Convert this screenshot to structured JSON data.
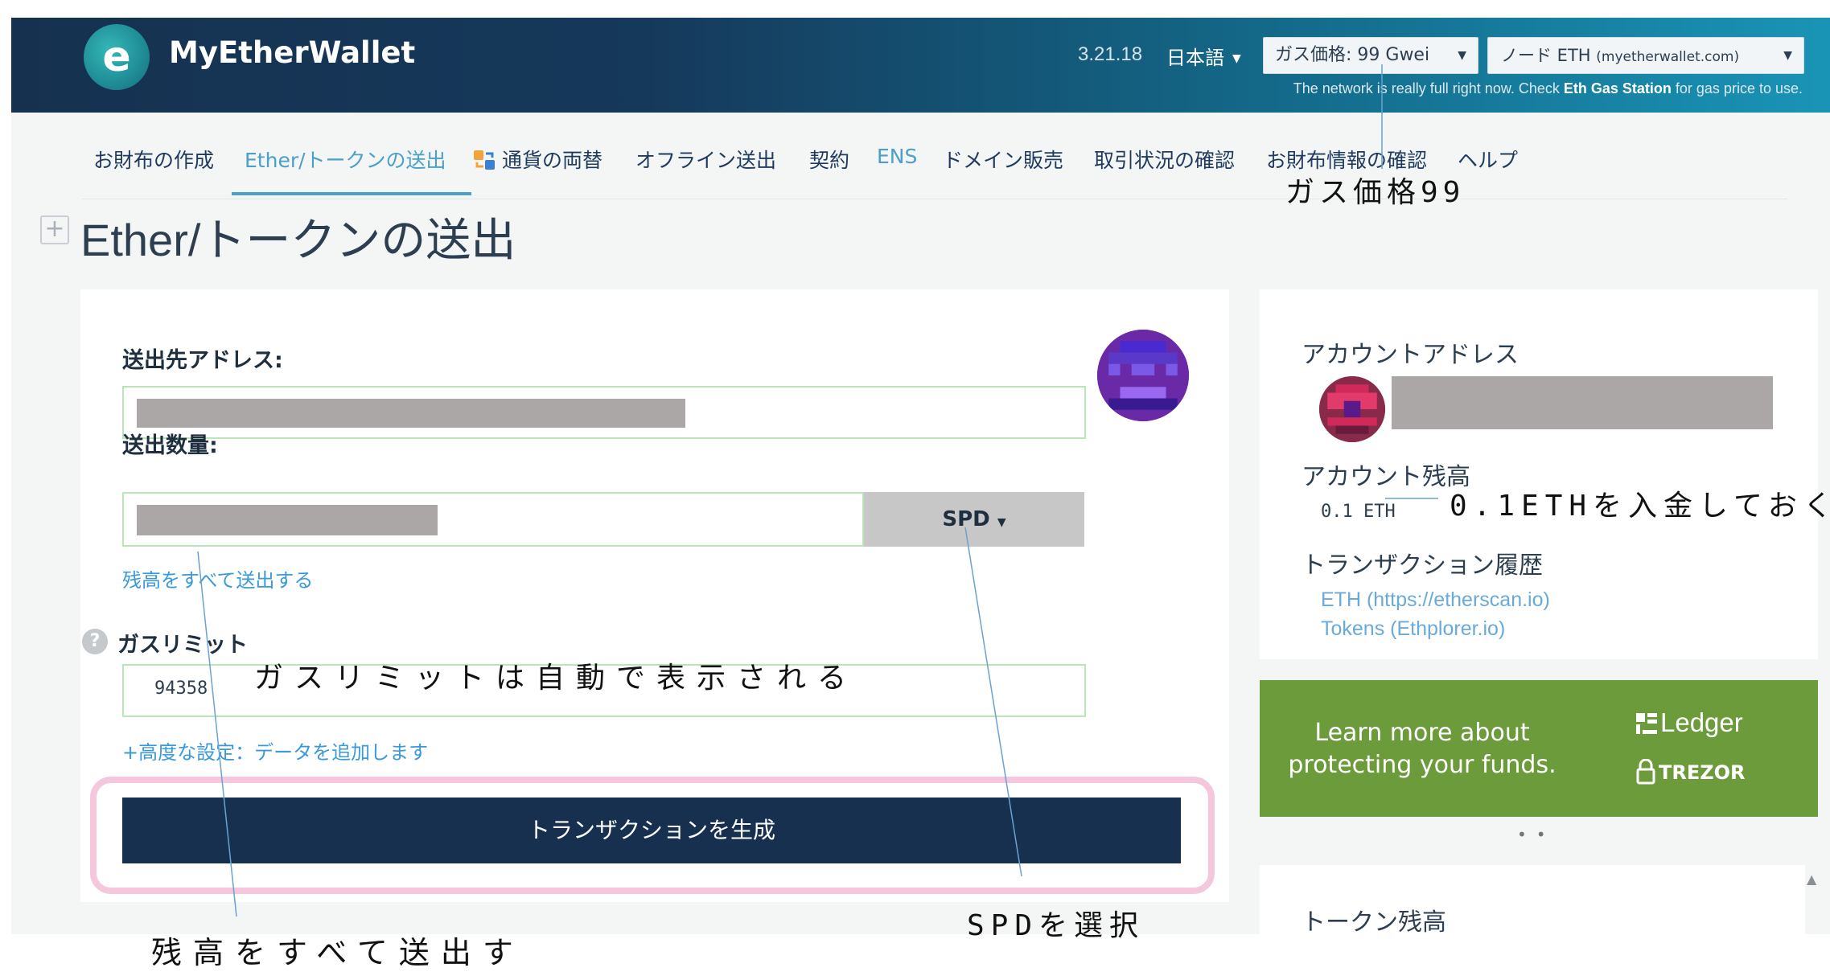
{
  "header": {
    "brand": "MyEtherWallet",
    "version": "3.21.18",
    "language": "日本語",
    "gas_price_button": "ガス価格: 99 Gwei",
    "node_button_main": "ノード ETH",
    "node_button_host": "(myetherwallet.com)",
    "network_note_prefix": "The network is really full right now. Check",
    "network_note_link": "Eth Gas Station",
    "network_note_suffix": "for gas price to use."
  },
  "nav": {
    "items": [
      {
        "label": "お財布の作成"
      },
      {
        "label": "Ether/トークンの送出"
      },
      {
        "label": "通貨の両替"
      },
      {
        "label": "オフライン送出"
      },
      {
        "label": "契約"
      },
      {
        "label": "ENS"
      },
      {
        "label": "ドメイン販売"
      },
      {
        "label": "取引状況の確認"
      },
      {
        "label": "お財布情報の確認"
      },
      {
        "label": "ヘルプ"
      }
    ],
    "active_index": 1
  },
  "page": {
    "expand_symbol": "+",
    "title_latin": "Ether/",
    "title_jp": "トークンの送出"
  },
  "send_form": {
    "to_address_label": "送出先アドレス:",
    "amount_label": "送出数量:",
    "unit": "SPD",
    "send_all_link": "残高をすべて送出する",
    "help_symbol": "?",
    "gas_limit_label": "ガスリミット",
    "gas_limit_value": "94358",
    "advanced_link": "+高度な設定：データを追加します",
    "generate_button": "トランザクションを生成"
  },
  "account": {
    "address_heading": "アカウントアドレス",
    "balance_heading": "アカウント残高",
    "balance_value": "0.1 ETH",
    "history_heading": "トランザクション履歴",
    "history_links": [
      "ETH (https://etherscan.io)",
      "Tokens (Ethplorer.io)"
    ]
  },
  "promo": {
    "text": "Learn more about protecting your funds.",
    "ledger": "Ledger",
    "trezor": "TREZOR",
    "dots": "••"
  },
  "token_balance": {
    "heading": "トークン残高"
  },
  "annotations": {
    "gas_price": "ガス価格99",
    "deposit": "0.1ETHを入金しておく",
    "gas_limit_note": "ガスリミットは自動で表示される",
    "send_all": "残高をすべて送出す",
    "select_spd": "SPDを選択"
  },
  "colors": {
    "header_dark": "#163150",
    "header_light": "#1a94b6",
    "nav_text": "#1e3a5f",
    "accent": "#4aa0c8",
    "field_border": "#b8e6b8",
    "generate_button": "#17304f",
    "highlight": "#f4c7dd",
    "promo_green": "#6b9b3a"
  }
}
